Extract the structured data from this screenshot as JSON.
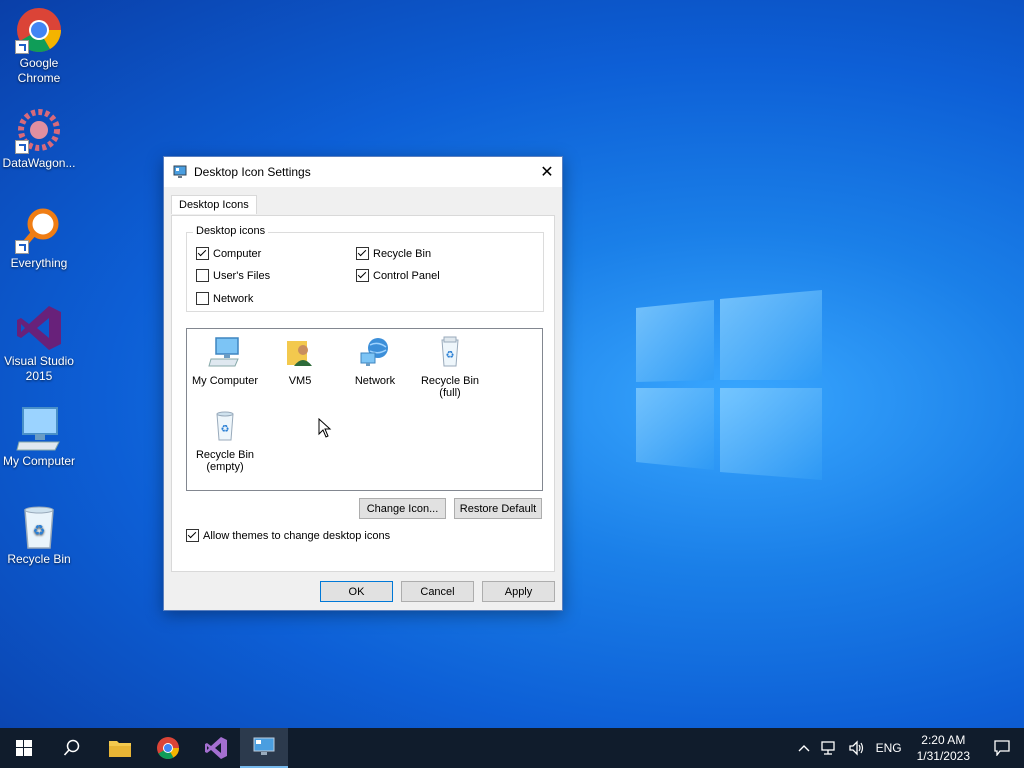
{
  "desktop": {
    "icons": [
      {
        "label": "Google\nChrome"
      },
      {
        "label": "DataWagon..."
      },
      {
        "label": "Everything"
      },
      {
        "label": "Visual Studio\n2015"
      },
      {
        "label": "My Computer"
      },
      {
        "label": "Recycle Bin"
      }
    ]
  },
  "dialog": {
    "title": "Desktop Icon Settings",
    "tab": "Desktop Icons",
    "group_label": "Desktop icons",
    "checkboxes": [
      {
        "label": "Computer",
        "checked": true
      },
      {
        "label": "User's Files",
        "checked": false
      },
      {
        "label": "Network",
        "checked": false
      },
      {
        "label": "Recycle Bin",
        "checked": true
      },
      {
        "label": "Control Panel",
        "checked": true
      }
    ],
    "icon_list": [
      {
        "label": "My Computer"
      },
      {
        "label": "VM5"
      },
      {
        "label": "Network"
      },
      {
        "label": "Recycle Bin\n(full)"
      },
      {
        "label": "Recycle Bin\n(empty)"
      }
    ],
    "change_icon_label": "Change Icon...",
    "restore_default_label": "Restore Default",
    "allow_themes_label": "Allow themes to change desktop icons",
    "allow_themes_checked": true,
    "ok_label": "OK",
    "cancel_label": "Cancel",
    "apply_label": "Apply"
  },
  "taskbar": {
    "language": "ENG",
    "time": "2:20 AM",
    "date": "1/31/2023"
  },
  "colors": {
    "accent": "#0078d7",
    "taskbar": "#101c2c"
  }
}
